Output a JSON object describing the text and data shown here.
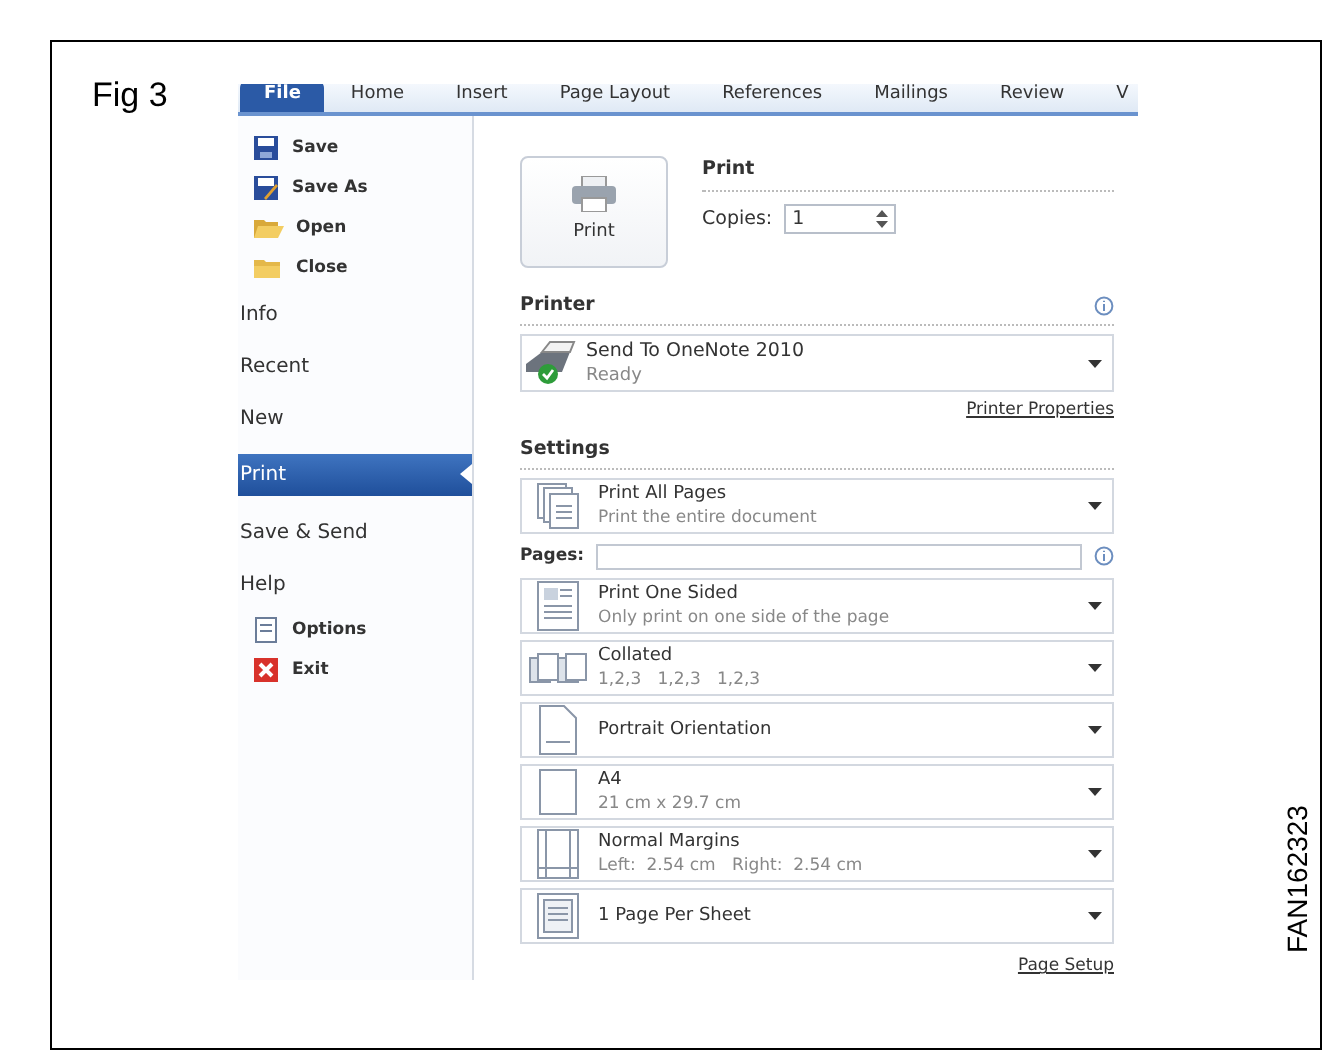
{
  "figure_label": "Fig 3",
  "ribbon_tabs": [
    {
      "label": "File",
      "selected": true
    },
    {
      "label": "Home",
      "selected": false
    },
    {
      "label": "Insert",
      "selected": false
    },
    {
      "label": "Page Layout",
      "selected": false
    },
    {
      "label": "References",
      "selected": false
    },
    {
      "label": "Mailings",
      "selected": false
    },
    {
      "label": "Review",
      "selected": false
    },
    {
      "label": "V",
      "selected": false
    }
  ],
  "sidebar": {
    "items": [
      {
        "label": "Save",
        "kind": "command",
        "selected": false
      },
      {
        "label": "Save As",
        "kind": "command",
        "selected": false
      },
      {
        "label": "Open",
        "kind": "command",
        "selected": false
      },
      {
        "label": "Close",
        "kind": "command",
        "selected": false
      },
      {
        "label": "Info",
        "kind": "page",
        "selected": false
      },
      {
        "label": "Recent",
        "kind": "page",
        "selected": false
      },
      {
        "label": "New",
        "kind": "page",
        "selected": false
      },
      {
        "label": "Print",
        "kind": "page",
        "selected": true
      },
      {
        "label": "Save & Send",
        "kind": "page",
        "selected": false
      },
      {
        "label": "Help",
        "kind": "page",
        "selected": false
      },
      {
        "label": "Options",
        "kind": "command",
        "selected": false
      },
      {
        "label": "Exit",
        "kind": "command",
        "selected": false
      }
    ]
  },
  "print": {
    "button": "Print",
    "heading": "Print",
    "copies_label": "Copies:",
    "copies_value": "1"
  },
  "printer": {
    "heading": "Printer",
    "name": "Send To OneNote 2010",
    "status": "Ready",
    "properties_link": "Printer Properties"
  },
  "settings": {
    "heading": "Settings",
    "pages_label": "Pages:",
    "options": [
      {
        "title": "Print All Pages",
        "subtitle": "Print the entire document"
      },
      {
        "kind": "pages_field"
      },
      {
        "title": "Print One Sided",
        "subtitle": "Only print on one side of the page"
      },
      {
        "title": "Collated",
        "subtitle": "1,2,3   1,2,3   1,2,3"
      },
      {
        "title": "Portrait Orientation"
      },
      {
        "title": "A4",
        "subtitle": "21 cm x 29.7 cm"
      },
      {
        "title": "Normal Margins",
        "subtitle": "Left:  2.54 cm   Right:  2.54 cm"
      },
      {
        "title": "1 Page Per Sheet"
      }
    ],
    "page_setup_link": "Page Setup"
  },
  "figure_code": "FAN162323"
}
